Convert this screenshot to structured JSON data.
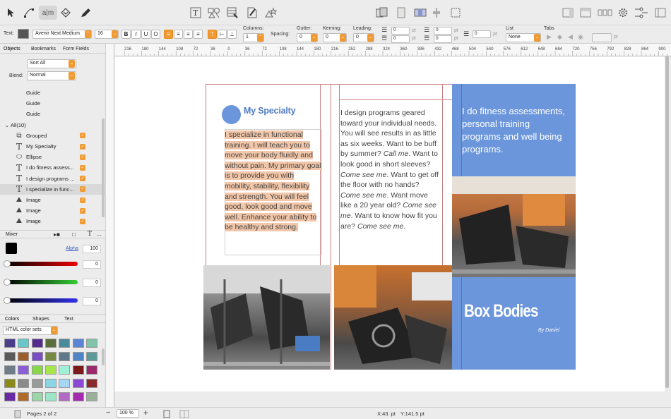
{
  "toolbar": {
    "text_tool_label": "a|m"
  },
  "format": {
    "text_label": "Text:",
    "font_name": "Avenir Next Medium",
    "font_size": "16",
    "bold": "B",
    "italic": "I",
    "underline": "U",
    "outline": "O",
    "columns_label": "Columns:",
    "columns_value": "1",
    "spacing_label": "Spacing:",
    "gutter_label": "Gutter:",
    "gutter_value": "0",
    "kerning_label": "Kerning:",
    "kerning_value": "0",
    "leading_label": "Leading:",
    "leading_value": "0",
    "indent_values": [
      "0",
      "0",
      "0",
      "0",
      "0"
    ],
    "unit": "pt",
    "list_label": "List",
    "list_value": "None",
    "tabs_label": "Tabs"
  },
  "sidebar": {
    "tabs": [
      "Objects",
      "Bookmarks",
      "Form Fields"
    ],
    "sort_value": "Sort All",
    "blend_label": "Blend:",
    "blend_value": "Normal",
    "items": [
      {
        "icon": "guide",
        "name": "Guide",
        "checked": false
      },
      {
        "icon": "guide",
        "name": "Guide",
        "checked": false
      },
      {
        "icon": "guide",
        "name": "Guide",
        "checked": false
      },
      {
        "icon": "folder",
        "name": "All(10)",
        "checked": false
      },
      {
        "icon": "group",
        "name": "Grouped",
        "checked": true
      },
      {
        "icon": "text",
        "name": "My Specialty",
        "checked": true
      },
      {
        "icon": "ellipse",
        "name": "Ellipse",
        "checked": true
      },
      {
        "icon": "text",
        "name": "I do fitness assess...",
        "checked": true
      },
      {
        "icon": "text",
        "name": "I design programs ...",
        "checked": true
      },
      {
        "icon": "text",
        "name": "I specialize in func...",
        "checked": true,
        "selected": true
      },
      {
        "icon": "image",
        "name": "Image",
        "checked": true
      },
      {
        "icon": "image",
        "name": "Image",
        "checked": true
      },
      {
        "icon": "image",
        "name": "Image",
        "checked": true
      }
    ],
    "mixer_label": "Mixer",
    "alpha_label": "Alpha",
    "alpha_value": "100",
    "rgb_values": [
      "0",
      "0",
      "0"
    ],
    "color_tabs": [
      "Colors",
      "Shapes",
      "Text"
    ],
    "palette_name": "HTML color sets",
    "swatches": [
      "#4b3f8c",
      "#66c8c8",
      "#552a8c",
      "#5a6e3c",
      "#4d8a99",
      "#5a85d6",
      "#7fc4a8",
      "#5a5a5a",
      "#9a5f2a",
      "#7a4fc4",
      "#778a44",
      "#5d7a8a",
      "#4e84c8",
      "#5c9a9a",
      "#6e7c8a",
      "#8a5fd6",
      "#8ad64a",
      "#a6e64a",
      "#a0f0d8",
      "#7a1a1a",
      "#9a2a6a",
      "#8a8a1a",
      "#8a8a8a",
      "#9a9a9a",
      "#8ad6e6",
      "#a6d6f6",
      "#8a4ad6",
      "#8a2a2a",
      "#6a2aa6",
      "#b06a2a",
      "#9ad6a6",
      "#9ae6c6",
      "#b06ac6",
      "#a62ab0",
      "#9ab09a"
    ]
  },
  "document": {
    "heading": "My Specialty",
    "col1_text": "I specialize in functional training.  I will teach you to move your body fluidly and without pain.  My primary goal is to provide you with mobility, stability, flexibility and strength.  You will feel good, look good and move well. Enhance your ability to be healthy and strong.",
    "col2_parts": [
      {
        "t": "I design programs geared toward your individual needs.  You will see results in as little as six weeks. Want to be buff by summer?  ",
        "em": false
      },
      {
        "t": "Call me",
        "em": true
      },
      {
        "t": ".  Want to look good in short sleeves?  ",
        "em": false
      },
      {
        "t": "Come see me",
        "em": true
      },
      {
        "t": ".  Want to get off the floor with no hands?  ",
        "em": false
      },
      {
        "t": "Come see me",
        "em": true
      },
      {
        "t": ".  Want move like a 20 year old?  ",
        "em": false
      },
      {
        "t": "Come see me",
        "em": true
      },
      {
        "t": ".  Want to know how fit you are?  ",
        "em": false
      },
      {
        "t": "Come see me",
        "em": true
      },
      {
        "t": ".",
        "em": false
      }
    ],
    "col3_text": "I do fitness assessments, personal training programs and well being programs.",
    "brand": "Box Bodies",
    "byline": "By Daniel",
    "accent": "#6b96dc",
    "highlight": "#f2c6a8"
  },
  "status": {
    "pages": "Pages 2 of 2",
    "zoom": "100 %",
    "x_coord": "X:43. pt",
    "y_coord": "Y:141.5 pt"
  },
  "ruler": {
    "h_labels": [
      "216",
      "180",
      "144",
      "108",
      "72",
      "36",
      "0",
      "36",
      "72",
      "108",
      "144",
      "180",
      "216",
      "252",
      "288",
      "324",
      "360",
      "396",
      "432",
      "468",
      "504",
      "540",
      "576",
      "612",
      "648",
      "684",
      "720",
      "756",
      "792",
      "828",
      "864",
      "900"
    ]
  }
}
